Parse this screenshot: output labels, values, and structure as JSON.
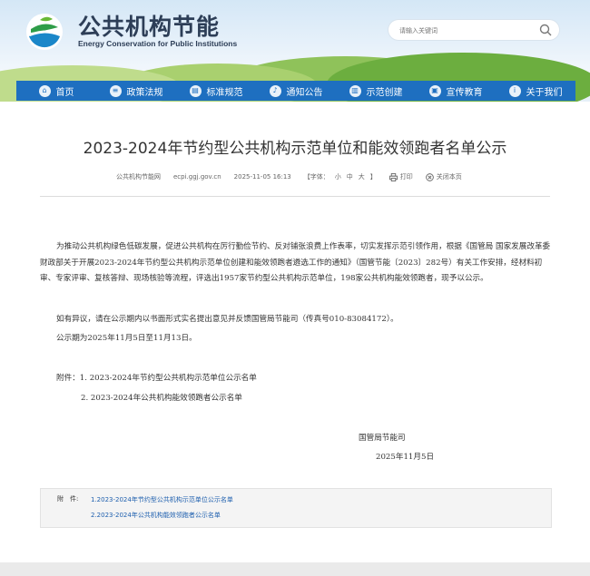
{
  "header": {
    "title": "公共机构节能",
    "subtitle": "Energy Conservation for Public Institutions",
    "search_placeholder": "请输入关键词"
  },
  "nav": [
    {
      "label": "首页",
      "icon": "home-icon"
    },
    {
      "label": "政策法规",
      "icon": "policy-icon"
    },
    {
      "label": "标准规范",
      "icon": "standard-icon"
    },
    {
      "label": "通知公告",
      "icon": "bell-icon"
    },
    {
      "label": "示范创建",
      "icon": "document-icon"
    },
    {
      "label": "宣传教育",
      "icon": "education-icon"
    },
    {
      "label": "关于我们",
      "icon": "info-icon"
    }
  ],
  "article": {
    "title": "2023-2024年节约型公共机构示范单位和能效领跑者名单公示",
    "source": "公共机构节能网",
    "domain": "ecpi.ggj.gov.cn",
    "datetime": "2025-11-05 16:13",
    "font_size_label": "【字体：",
    "font_small": "小",
    "font_medium": "中",
    "font_large": "大",
    "font_close": "】",
    "print_label": "打印",
    "close_label": "关闭本页",
    "p1": "为推动公共机构绿色低碳发展，促进公共机构在厉行勤俭节约、反对铺张浪费上作表率，切实发挥示范引领作用，根据《国管局 国家发展改革委 财政部关于开展2023-2024年节约型公共机构示范单位创建和能效领跑者遴选工作的通知》（国管节能〔2023〕282号）有关工作安排，经材料初审、专家评审、复核答辩、现场核验等流程，评选出1957家节约型公共机构示范单位，198家公共机构能效领跑者，现予以公示。",
    "p2": "如有异议，请在公示期内以书面形式实名提出意见并反馈国管局节能司（传真号010-83084172）。",
    "p3": "公示期为2025年11月5日至11月13日。",
    "attachment1": "附件：1. 2023-2024年节约型公共机构示范单位公示名单",
    "attachment2": "2. 2023-2024年公共机构能效领跑者公示名单",
    "signature": "国管局节能司",
    "sign_date": "2025年11月5日"
  },
  "attachments_box": {
    "label": "附　件:",
    "link1": "1.2023-2024年节约型公共机构示范单位公示名单",
    "link2": "2.2023-2024年公共机构能效领跑者公示名单"
  },
  "colors": {
    "nav_blue": "#1e6fc0",
    "brand_text": "#2d3e57",
    "link": "#1e5fae"
  }
}
